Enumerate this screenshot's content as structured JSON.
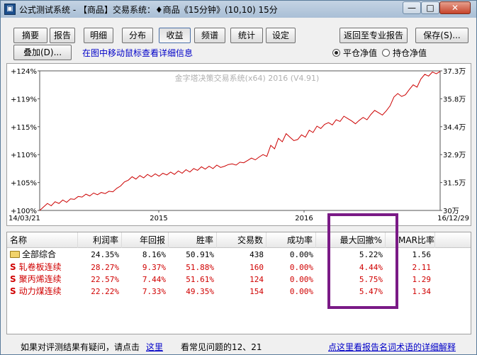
{
  "window": {
    "title": "公式测试系统 - 【商品】交易系统：♦商品《15分钟》(10,10) 15分",
    "minimize_glyph": "—",
    "maximize_glyph": "□",
    "close_glyph": "✕"
  },
  "tabs": [
    {
      "label": "摘要"
    },
    {
      "label": "报告"
    },
    {
      "label": "明细"
    },
    {
      "label": "分布"
    },
    {
      "label": "收益"
    },
    {
      "label": "频谱"
    },
    {
      "label": "统计"
    },
    {
      "label": "设定"
    }
  ],
  "active_tab": "收益",
  "buttons": {
    "back": "返回至专业报告",
    "save": "保存(S)...",
    "overlay": "叠加(D)..."
  },
  "info_text": "在图中移动鼠标查看详细信息",
  "radios": {
    "flat": "平仓净值",
    "hold": "持仓净值",
    "selected": "flat"
  },
  "chart_data": {
    "type": "line",
    "watermark": "金字塔决策交易系统(x64) 2016 (V4.91)",
    "y_left_ticks": [
      "+124%",
      "+119%",
      "+115%",
      "+110%",
      "+105%",
      "+100%"
    ],
    "y_right_ticks": [
      "37.3万",
      "35.8万",
      "34.4万",
      "32.9万",
      "31.5万",
      "30万"
    ],
    "x_ticks": [
      "14/03/21",
      "2015",
      "2016",
      "16/12/29"
    ],
    "ylim": [
      100,
      124
    ],
    "line_color": "#cc0000",
    "grid": false,
    "values": [
      100.0,
      100.6,
      101.2,
      100.8,
      101.5,
      101.2,
      101.8,
      101.4,
      102.0,
      101.9,
      102.4,
      102.3,
      102.8,
      102.5,
      103.0,
      102.7,
      103.1,
      102.9,
      103.3,
      103.2,
      103.8,
      104.2,
      104.9,
      105.2,
      105.8,
      105.4,
      106.0,
      105.6,
      106.2,
      105.8,
      106.3,
      105.9,
      106.4,
      106.1,
      106.6,
      106.2,
      106.8,
      106.4,
      107.0,
      106.6,
      107.2,
      106.9,
      107.5,
      107.1,
      107.6,
      107.2,
      107.8,
      107.4,
      107.6,
      107.9,
      108.0,
      107.8,
      108.3,
      108.2,
      108.6,
      109.0,
      108.7,
      109.2,
      109.6,
      109.3,
      111.2,
      110.6,
      112.4,
      111.8,
      113.2,
      112.6,
      112.0,
      112.2,
      113.0,
      112.6,
      113.8,
      113.4,
      114.5,
      114.1,
      114.8,
      115.1,
      114.7,
      115.6,
      115.3,
      116.2,
      115.8,
      115.4,
      114.9,
      115.5,
      116.0,
      115.6,
      116.5,
      117.2,
      116.8,
      116.4,
      117.1,
      118.0,
      119.5,
      120.1,
      119.6,
      119.9,
      120.8,
      121.6,
      121.2,
      122.6,
      123.4,
      123.1,
      123.8,
      123.5,
      123.9
    ]
  },
  "table": {
    "headers": [
      "名称",
      "利润率",
      "年回报",
      "胜率",
      "交易数",
      "成功率",
      "最大回撤%",
      "MAR比率"
    ],
    "summary": {
      "name": "全部综合",
      "values": [
        "24.35%",
        "8.16%",
        "50.91%",
        "438",
        "0.00%",
        "5.22%",
        "1.56"
      ]
    },
    "rows": [
      {
        "mark": "S",
        "name": "轧卷板连续",
        "values": [
          "28.27%",
          "9.37%",
          "51.88%",
          "160",
          "0.00%",
          "4.44%",
          "2.11"
        ]
      },
      {
        "mark": "S",
        "name": "聚丙烯连续",
        "values": [
          "22.57%",
          "7.44%",
          "51.61%",
          "124",
          "0.00%",
          "5.75%",
          "1.29"
        ]
      },
      {
        "mark": "S",
        "name": "动力煤连续",
        "values": [
          "22.22%",
          "7.33%",
          "49.35%",
          "154",
          "0.00%",
          "5.47%",
          "1.34"
        ]
      }
    ]
  },
  "footer": {
    "note": "如果对评测结果有疑问，请点击",
    "link1": "这里",
    "faq": "看常见问题的12、21",
    "link2": "点这里看报告名词术语的详细解释"
  }
}
